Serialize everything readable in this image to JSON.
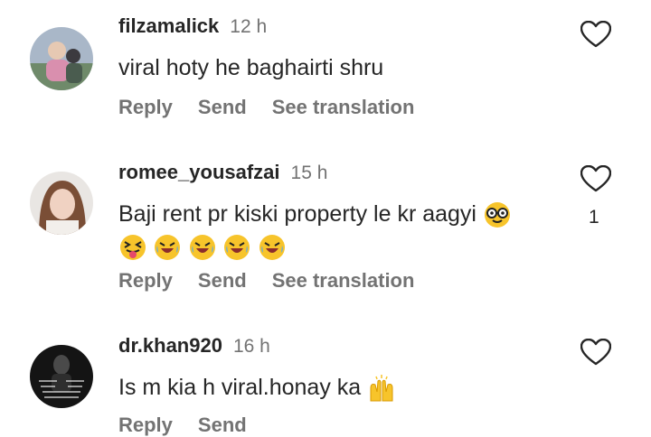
{
  "comments": [
    {
      "username": "filzamalick",
      "time": "12 h",
      "text": "viral hoty he baghairti shru",
      "reply_label": "Reply",
      "send_label": "Send",
      "translate_label": "See translation"
    },
    {
      "username": "romee_yousafzai",
      "time": "15 h",
      "text": "Baji rent pr kiski property le kr aagyi",
      "likes": "1",
      "reply_label": "Reply",
      "send_label": "Send",
      "translate_label": "See translation"
    },
    {
      "username": "dr.khan920",
      "time": "16 h",
      "text": "Is m kia h viral.honay ka",
      "reply_label": "Reply",
      "send_label": "Send"
    }
  ],
  "icons": {
    "heart": "heart-outline-icon",
    "emoji_nerd": "nerd-face-emoji",
    "emoji_squint_tongue": "squinting-face-with-tongue-emoji",
    "emoji_rofl": "rolling-on-floor-laughing-emoji",
    "emoji_raised_hands": "raising-hands-emoji"
  },
  "colors": {
    "text": "#262626",
    "secondary": "#737373",
    "background": "#ffffff"
  }
}
